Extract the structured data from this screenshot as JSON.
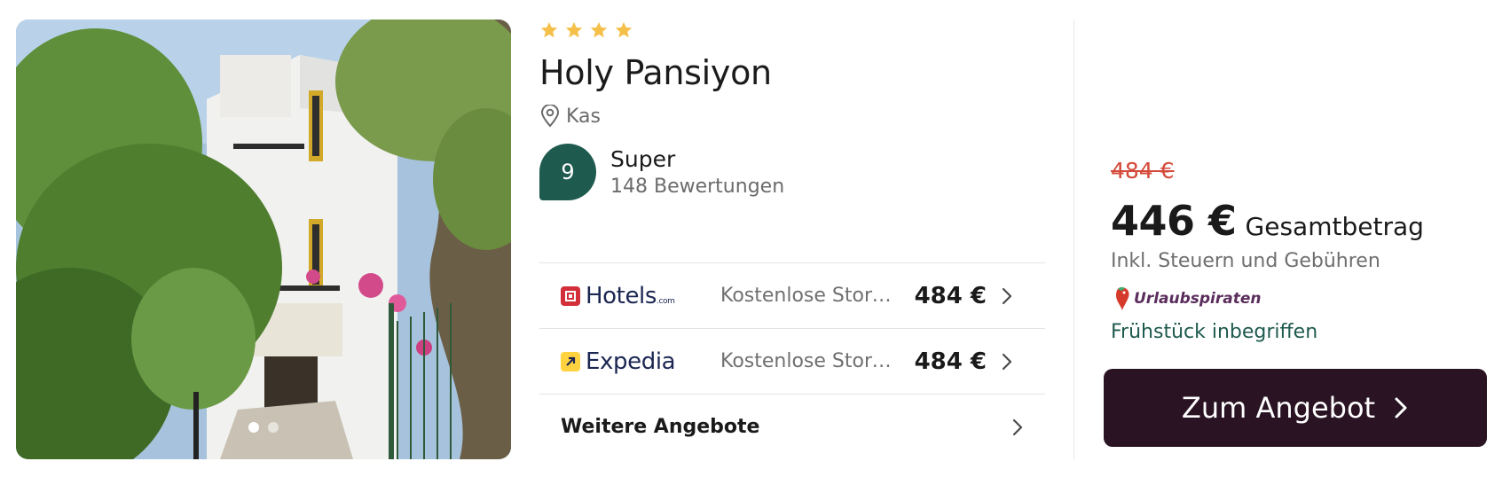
{
  "hotel": {
    "stars": 4,
    "star_color": "#f5c04a",
    "name": "Holy Pansiyon",
    "location": "Kas",
    "rating_score": "9",
    "rating_label": "Super",
    "reviews": "148 Bewertungen",
    "rating_color": "#1e5a4e"
  },
  "gallery": {
    "image_count": 2,
    "active_index": 0
  },
  "offers": [
    {
      "provider": "Hotels",
      "provider_suffix": ".com",
      "logo_icon": "hotels-com-logo-icon",
      "logo_color": "#d32f3a",
      "description": "Kostenlose Stornierung",
      "price": "484 €"
    },
    {
      "provider": "Expedia",
      "provider_suffix": "",
      "logo_icon": "expedia-logo-icon",
      "logo_color": "#ffd23f",
      "description": "Kostenlose Stornierung",
      "price": "484 €"
    }
  ],
  "more_offers": "Weitere Angebote",
  "deal": {
    "old_price": "484 €",
    "price": "446 €",
    "price_suffix": "Gesamtbetrag",
    "tax_note": "Inkl. Steuern und Gebühren",
    "partner": "Urlaubspiraten",
    "partner_icon": "urlaubspiraten-parrot-icon",
    "feature": "Frühstück inbegriffen",
    "cta": "Zum Angebot",
    "cta_color": "#2a1424",
    "old_price_color": "#d44a3a"
  }
}
